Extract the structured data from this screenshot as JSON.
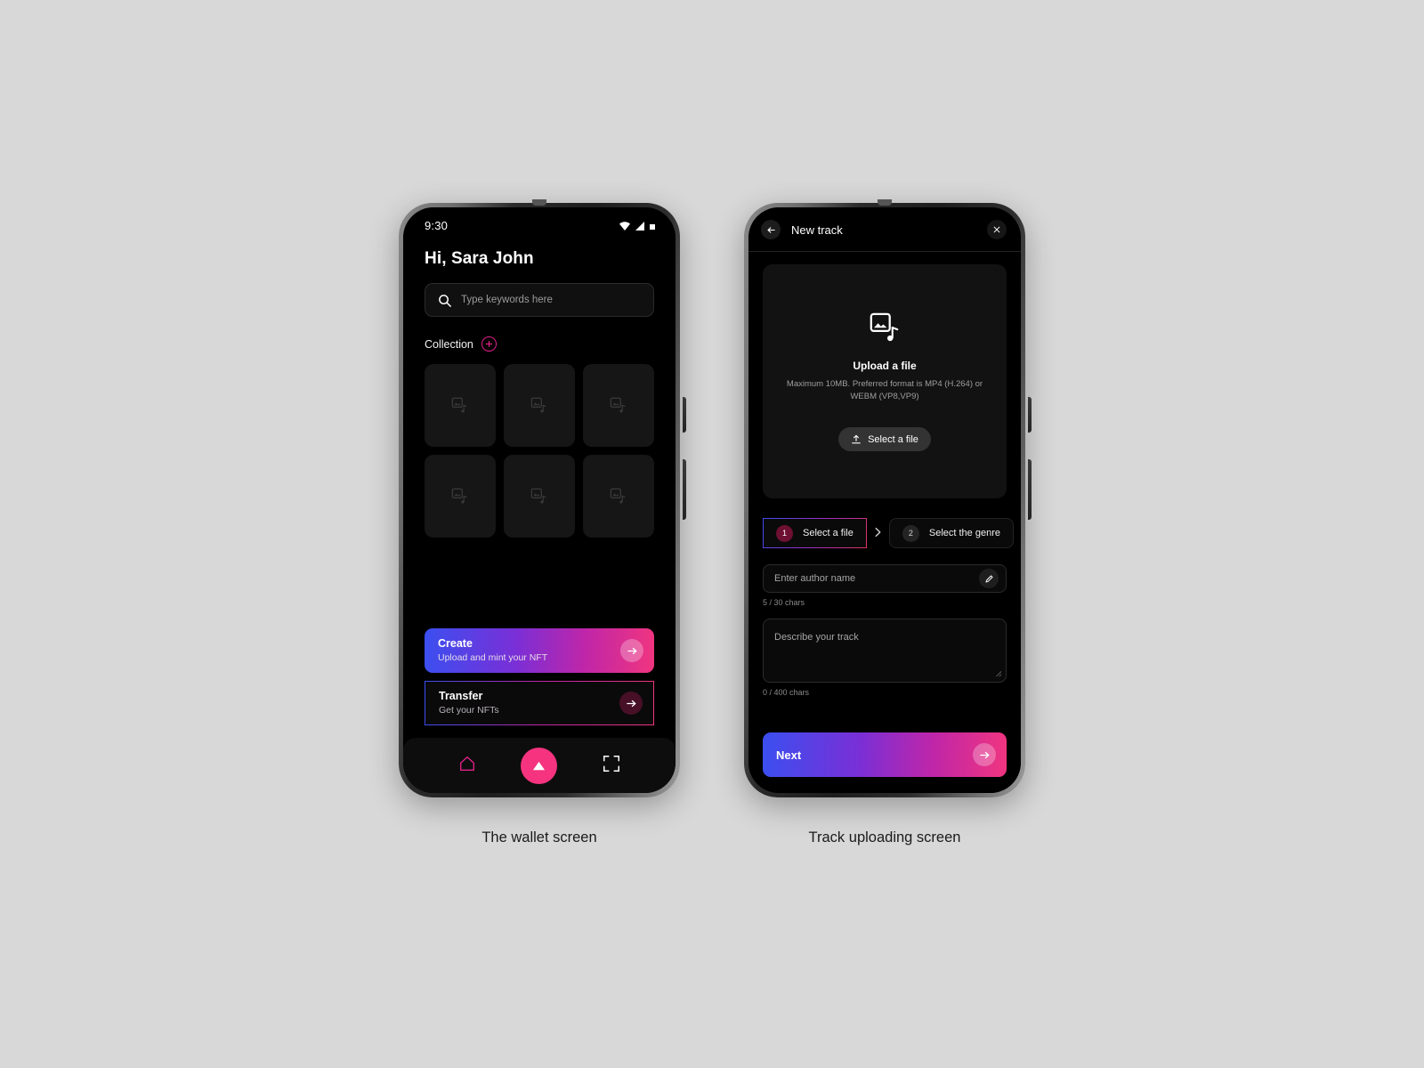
{
  "background_color": "#d8d8d8",
  "accent": {
    "pink": "#e0218a",
    "fab_pink": "#f5337f",
    "gradient_start": "#3b4ff0",
    "gradient_mid": "#a02cc0",
    "gradient_end": "#f0357f"
  },
  "wallet": {
    "caption": "The wallet screen",
    "status_bar": {
      "time": "9:30",
      "icons": [
        "wifi-icon",
        "signal-icon",
        "battery-icon"
      ]
    },
    "greeting": "Hi, Sara John",
    "search": {
      "icon": "search-icon",
      "placeholder": "Type keywords here",
      "value": ""
    },
    "collection": {
      "label": "Collection",
      "add_icon": "plus-circle-icon"
    },
    "cards": [
      {
        "placeholder_icon": "image-music-icon"
      },
      {
        "placeholder_icon": "image-music-icon"
      },
      {
        "placeholder_icon": "image-music-icon"
      },
      {
        "placeholder_icon": "image-music-icon"
      },
      {
        "placeholder_icon": "image-music-icon"
      },
      {
        "placeholder_icon": "image-music-icon"
      }
    ],
    "actions": [
      {
        "title": "Create",
        "subtitle": "Upload and mint your NFT",
        "arrow_icon": "arrow-right-icon",
        "style": "gradient"
      },
      {
        "title": "Transfer",
        "subtitle": "Get your NFTs",
        "arrow_icon": "arrow-right-icon",
        "style": "outline"
      }
    ],
    "navbar": {
      "home_icon": "home-icon",
      "fab_icon": "triangle-up-icon",
      "scan_icon": "scan-frame-icon"
    }
  },
  "new_track": {
    "caption": "Track uploading screen",
    "header": {
      "back_icon": "arrow-left-icon",
      "title": "New track",
      "close_icon": "close-icon"
    },
    "dropzone": {
      "icon": "image-music-icon",
      "title": "Upload a file",
      "subtitle": "Maximum 10MB. Preferred format is MP4 (H.264) or WEBM (VP8,VP9)",
      "button": {
        "icon": "upload-icon",
        "label": "Select a file"
      }
    },
    "steps": [
      {
        "number": "1",
        "label": "Select a file",
        "state": "active"
      },
      {
        "number": "2",
        "label": "Select the genre",
        "state": "inactive"
      }
    ],
    "step_separator_icon": "chevron-right-icon",
    "author_field": {
      "placeholder": "Enter author name",
      "value": "",
      "edit_icon": "pencil-icon",
      "counter": "5 / 30 chars"
    },
    "description_field": {
      "placeholder": "Describe your track",
      "value": "",
      "counter": "0 / 400 chars",
      "resize_icon": "resize-handle-icon"
    },
    "next_button": {
      "label": "Next",
      "arrow_icon": "arrow-right-icon"
    }
  }
}
